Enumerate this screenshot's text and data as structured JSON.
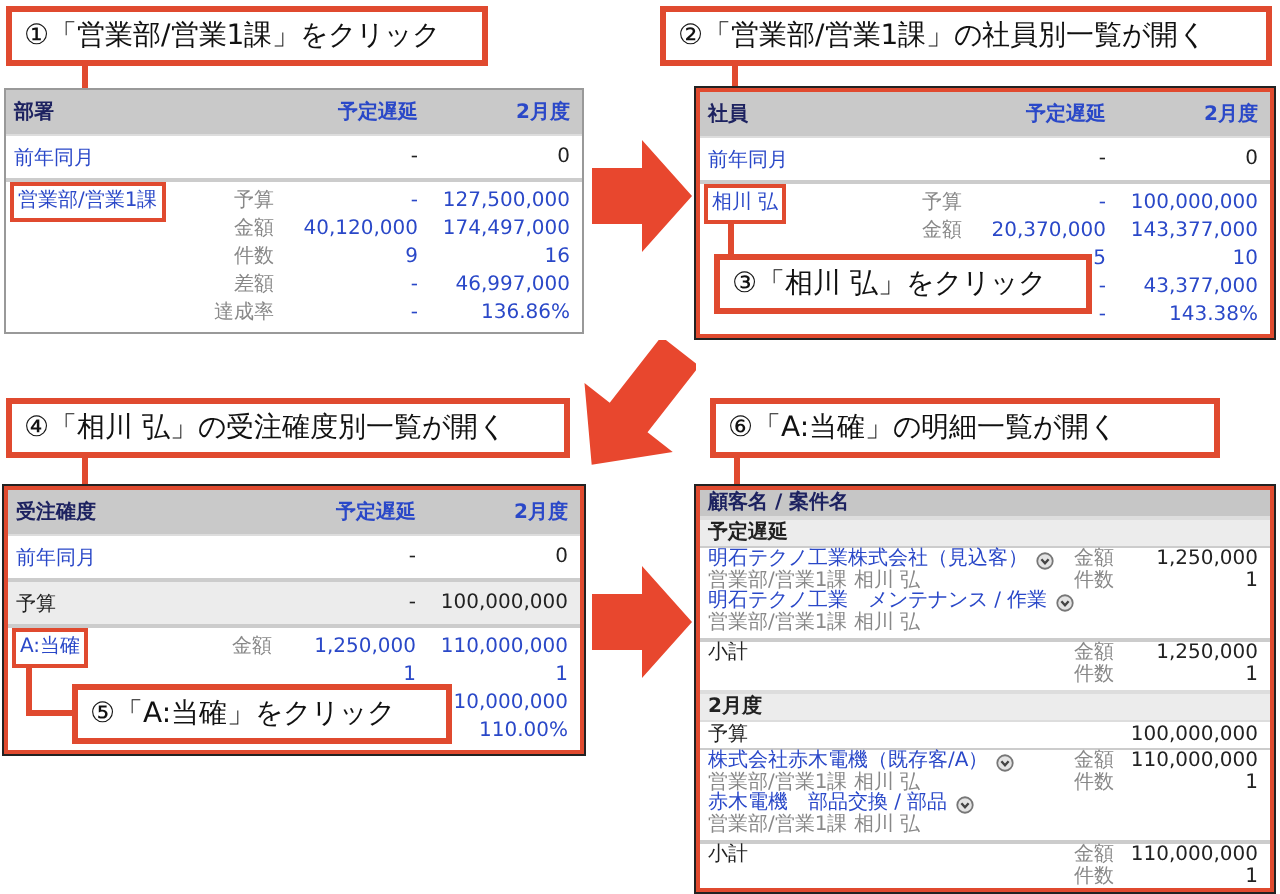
{
  "callouts": [
    "①「営業部/営業1課」をクリック",
    "②「営業部/営業1課」の社員別一覧が開く",
    "③「相川 弘」をクリック",
    "④「相川 弘」の受注確度別一覧が開く",
    "⑤「A:当確」をクリック",
    "⑥「A:当確」の明細一覧が開く"
  ],
  "tables": [
    {
      "highlighted": false,
      "columns": [
        "部署",
        "予定遅延",
        "2月度"
      ],
      "rows": [
        {
          "kind": "plain",
          "label": "前年同月",
          "link": true,
          "plan": "-",
          "month": "0"
        },
        {
          "kind": "group",
          "label": "営業部/営業1課",
          "link": true,
          "highlighted": true,
          "metrics": [
            {
              "label": "予算",
              "plan": "-",
              "month": "127,500,000"
            },
            {
              "label": "金額",
              "plan": "40,120,000",
              "month": "174,497,000"
            },
            {
              "label": "件数",
              "plan": "9",
              "month": "16"
            },
            {
              "label": "差額",
              "plan": "-",
              "month": "46,997,000"
            },
            {
              "label": "達成率",
              "plan": "-",
              "month": "136.86%"
            }
          ]
        }
      ]
    },
    {
      "highlighted": true,
      "columns": [
        "社員",
        "予定遅延",
        "2月度"
      ],
      "rows": [
        {
          "kind": "plain",
          "label": "前年同月",
          "link": true,
          "plan": "-",
          "month": "0"
        },
        {
          "kind": "group",
          "label": "相川 弘",
          "link": true,
          "highlighted": true,
          "metrics": [
            {
              "label": "予算",
              "plan": "-",
              "month": "100,000,000"
            },
            {
              "label": "金額",
              "plan": "20,370,000",
              "month": "143,377,000"
            },
            {
              "plan": "5",
              "month": "10"
            },
            {
              "plan": "-",
              "month": "43,377,000"
            },
            {
              "plan": "-",
              "month": "143.38%"
            }
          ]
        }
      ]
    },
    {
      "highlighted": true,
      "columns": [
        "受注確度",
        "予定遅延",
        "2月度"
      ],
      "rows": [
        {
          "kind": "plain",
          "label": "前年同月",
          "link": true,
          "plan": "-",
          "month": "0"
        },
        {
          "kind": "shaded",
          "label": "予算",
          "link": false,
          "plan": "-",
          "month": "100,000,000"
        },
        {
          "kind": "group",
          "label": "A:当確",
          "link": true,
          "highlighted": true,
          "metrics": [
            {
              "label": "金額",
              "plan": "1,250,000",
              "month": "110,000,000"
            },
            {
              "plan": "1",
              "month": "1"
            },
            {
              "month": "10,000,000"
            },
            {
              "month": "110.00%"
            }
          ]
        }
      ]
    }
  ],
  "detail": {
    "header": "顧客名 / 案件名",
    "rows": [
      {
        "kind": "section",
        "label": "予定遅延"
      },
      {
        "kind": "items",
        "entries": [
          {
            "name": "明石テクノ工業株式会社（見込客）",
            "owner": "営業部/営業1課 相川 弘"
          },
          {
            "name": "明石テクノ工業　メンテナンス / 作業",
            "owner": "営業部/営業1課 相川 弘"
          }
        ],
        "metrics": [
          {
            "label": "金額",
            "value": "1,250,000"
          },
          {
            "label": "件数",
            "value": "1"
          }
        ]
      },
      {
        "kind": "subtotal",
        "label": "小計",
        "metrics": [
          {
            "label": "金額",
            "value": "1,250,000"
          },
          {
            "label": "件数",
            "value": "1"
          }
        ]
      },
      {
        "kind": "section",
        "label": "2月度"
      },
      {
        "kind": "budget",
        "label": "予算",
        "value": "100,000,000"
      },
      {
        "kind": "items",
        "entries": [
          {
            "name": "株式会社赤木電機（既存客/A）",
            "owner": "営業部/営業1課 相川 弘"
          },
          {
            "name": "赤木電機　部品交換 / 部品",
            "owner": "営業部/営業1課 相川 弘"
          }
        ],
        "metrics": [
          {
            "label": "金額",
            "value": "110,000,000"
          },
          {
            "label": "件数",
            "value": "1"
          }
        ]
      },
      {
        "kind": "subtotal",
        "label": "小計",
        "metrics": [
          {
            "label": "金額",
            "value": "110,000,000"
          },
          {
            "label": "件数",
            "value": "1"
          }
        ]
      }
    ]
  }
}
